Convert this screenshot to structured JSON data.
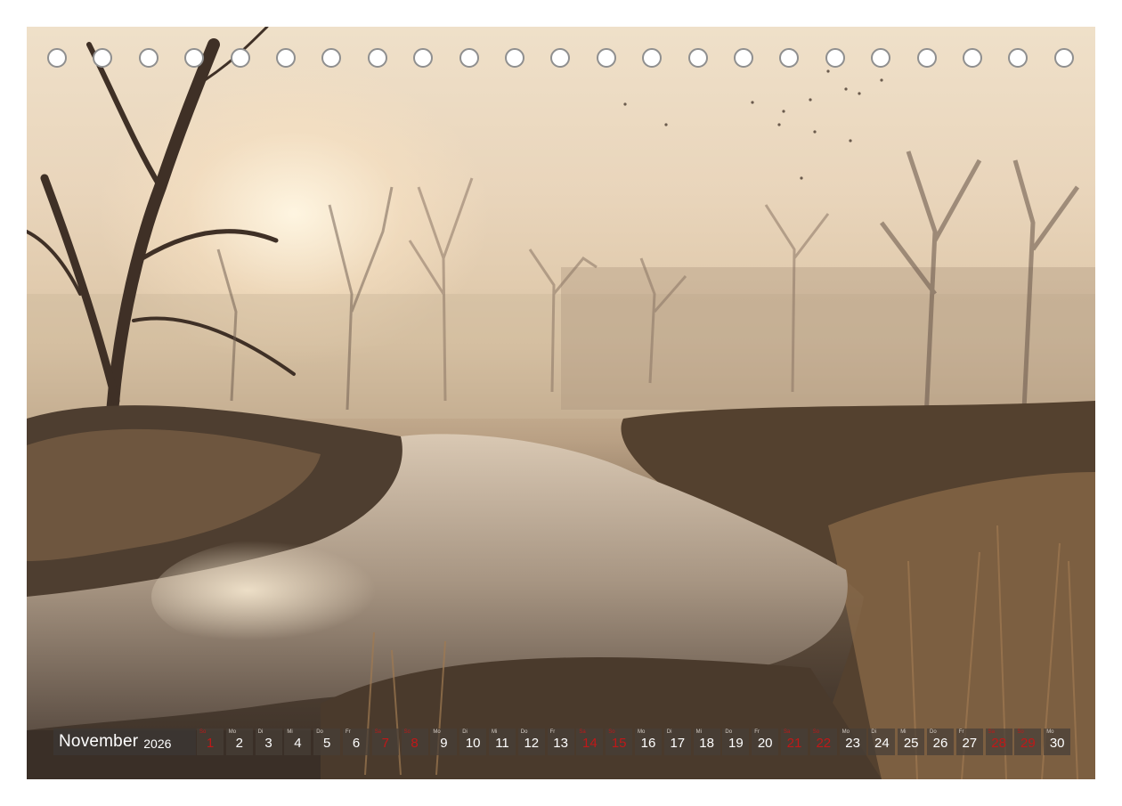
{
  "calendar": {
    "month": "November",
    "year": "2026",
    "days": [
      {
        "d": "1",
        "w": "So",
        "red": true
      },
      {
        "d": "2",
        "w": "Mo",
        "red": false
      },
      {
        "d": "3",
        "w": "Di",
        "red": false
      },
      {
        "d": "4",
        "w": "Mi",
        "red": false
      },
      {
        "d": "5",
        "w": "Do",
        "red": false
      },
      {
        "d": "6",
        "w": "Fr",
        "red": false
      },
      {
        "d": "7",
        "w": "Sa",
        "red": true
      },
      {
        "d": "8",
        "w": "So",
        "red": true
      },
      {
        "d": "9",
        "w": "Mo",
        "red": false
      },
      {
        "d": "10",
        "w": "Di",
        "red": false
      },
      {
        "d": "11",
        "w": "Mi",
        "red": false
      },
      {
        "d": "12",
        "w": "Do",
        "red": false
      },
      {
        "d": "13",
        "w": "Fr",
        "red": false
      },
      {
        "d": "14",
        "w": "Sa",
        "red": true
      },
      {
        "d": "15",
        "w": "So",
        "red": true
      },
      {
        "d": "16",
        "w": "Mo",
        "red": false
      },
      {
        "d": "17",
        "w": "Di",
        "red": false
      },
      {
        "d": "18",
        "w": "Mi",
        "red": false
      },
      {
        "d": "19",
        "w": "Do",
        "red": false
      },
      {
        "d": "20",
        "w": "Fr",
        "red": false
      },
      {
        "d": "21",
        "w": "Sa",
        "red": true
      },
      {
        "d": "22",
        "w": "So",
        "red": true
      },
      {
        "d": "23",
        "w": "Mo",
        "red": false
      },
      {
        "d": "24",
        "w": "Di",
        "red": false
      },
      {
        "d": "25",
        "w": "Mi",
        "red": false
      },
      {
        "d": "26",
        "w": "Do",
        "red": false
      },
      {
        "d": "27",
        "w": "Fr",
        "red": false
      },
      {
        "d": "28",
        "w": "Sa",
        "red": true
      },
      {
        "d": "29",
        "w": "So",
        "red": true
      },
      {
        "d": "30",
        "w": "Mo",
        "red": false
      }
    ]
  },
  "binding_rings": 23,
  "colors": {
    "holiday": "#c01818",
    "strip": "#463e38",
    "ring_border": "#8f8f8f"
  }
}
